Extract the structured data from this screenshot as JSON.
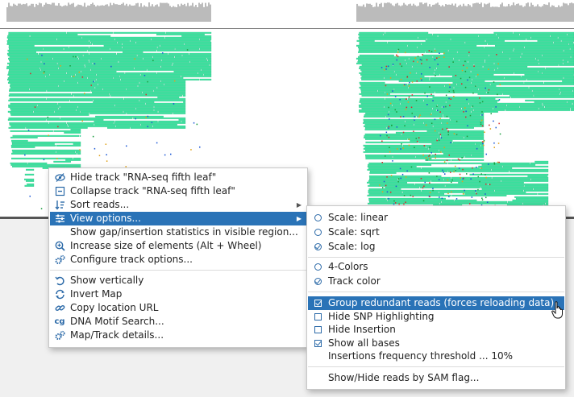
{
  "track": {
    "name": "RNA-seq fifth leaf",
    "read_color": "#3ee8a2",
    "read_edge_color": "#1cb47a",
    "coverage_color": "#bbbbbb",
    "mismatch_colors": [
      "#1a56d6",
      "#d62d2d",
      "#e0a21a",
      "#1b9e3f"
    ]
  },
  "context_menu": {
    "items": [
      {
        "label": "Hide track \"RNA-seq fifth leaf\"",
        "icon": "eye-slash-icon"
      },
      {
        "label": "Collapse track \"RNA-seq fifth leaf\"",
        "icon": "collapse-icon"
      },
      {
        "label": "Sort reads...",
        "icon": "sort-icon",
        "submenu": true
      },
      {
        "label": "View options...",
        "icon": "sliders-icon",
        "submenu": true,
        "highlighted": true
      },
      {
        "label": "Show gap/insertion statistics in visible region...",
        "icon": ""
      },
      {
        "label": "Increase size of elements (Alt + Wheel)",
        "icon": "zoom-in-icon"
      },
      {
        "label": "Configure track options...",
        "icon": "cogs-icon"
      },
      {
        "label": "Show vertically",
        "icon": "undo-icon"
      },
      {
        "label": "Invert Map",
        "icon": "refresh-icon"
      },
      {
        "label": "Copy location URL",
        "icon": "link-icon"
      },
      {
        "label": "DNA Motif Search...",
        "icon": "motif-icon"
      },
      {
        "label": "Map/Track details...",
        "icon": "cogs-icon"
      }
    ]
  },
  "view_options_menu": {
    "items": [
      {
        "label": "Scale: linear",
        "control": "radio",
        "checked": false
      },
      {
        "label": "Scale: sqrt",
        "control": "radio",
        "checked": false
      },
      {
        "label": "Scale: log",
        "control": "radio",
        "checked": true
      },
      {
        "label": "4-Colors",
        "control": "radio",
        "checked": false
      },
      {
        "label": "Track color",
        "control": "radio",
        "checked": true
      },
      {
        "label": "Group redundant reads (forces reloading data)",
        "control": "checkbox",
        "checked": true,
        "highlighted": true
      },
      {
        "label": "Hide SNP Highlighting",
        "control": "checkbox",
        "checked": false
      },
      {
        "label": "Hide Insertion",
        "control": "checkbox",
        "checked": false
      },
      {
        "label": "Show all bases",
        "control": "checkbox",
        "checked": true
      },
      {
        "label": "Insertions frequency threshold ... 10%",
        "control": "none"
      },
      {
        "label": "Show/Hide reads by SAM flag...",
        "control": "none"
      }
    ]
  }
}
